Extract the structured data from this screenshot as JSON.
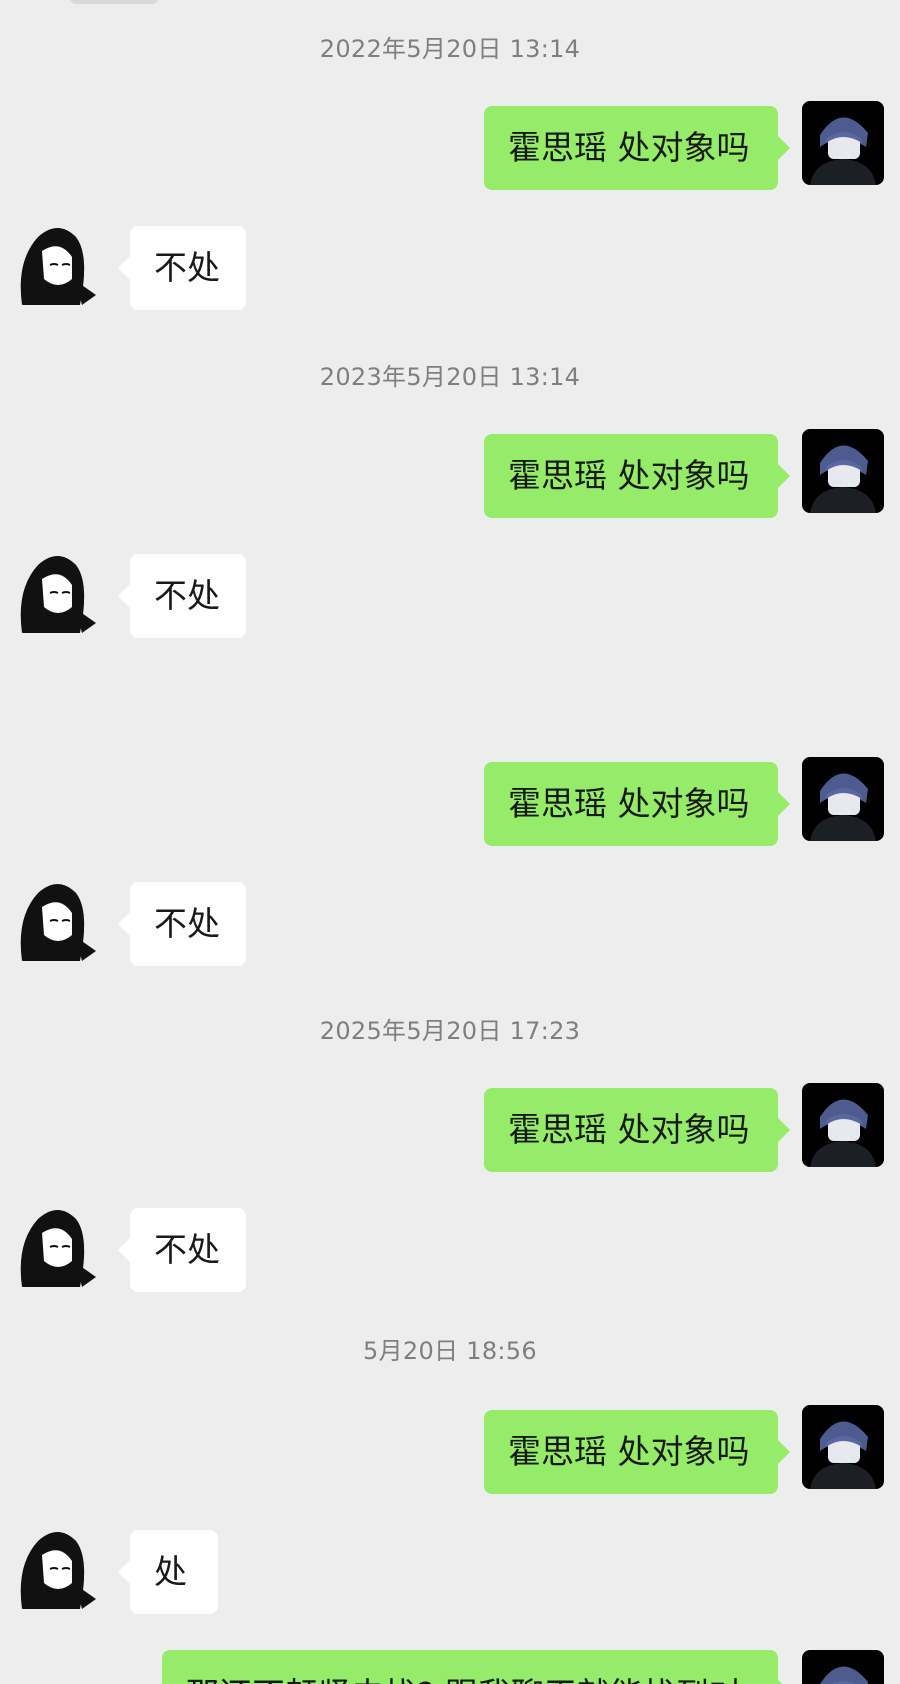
{
  "timestamps": [
    "2022年5月20日 13:14",
    "2023年5月20日 13:14",
    "2025年5月20日 17:23",
    "5月20日 18:56"
  ],
  "messages": [
    {
      "sender": "me",
      "text": "霍思瑶 处对象吗"
    },
    {
      "sender": "them",
      "text": "不处"
    },
    {
      "sender": "me",
      "text": "霍思瑶 处对象吗"
    },
    {
      "sender": "them",
      "text": "不处"
    },
    {
      "sender": "me",
      "text": "霍思瑶 处对象吗"
    },
    {
      "sender": "them",
      "text": "不处"
    },
    {
      "sender": "me",
      "text": "霍思瑶 处对象吗"
    },
    {
      "sender": "them",
      "text": "不处"
    },
    {
      "sender": "me",
      "text": "霍思瑶 处对象吗"
    },
    {
      "sender": "them",
      "text": "处"
    },
    {
      "sender": "me",
      "text": "那还不赶紧去找?,跟我聊天就能找到对"
    }
  ],
  "colors": {
    "background": "#ededed",
    "sent_bubble": "#95ec69",
    "received_bubble": "#ffffff",
    "timestamp_text": "#7f7f7f"
  },
  "icons": {
    "me_avatar": "boy-avatar-icon",
    "them_avatar": "girl-avatar-icon"
  }
}
